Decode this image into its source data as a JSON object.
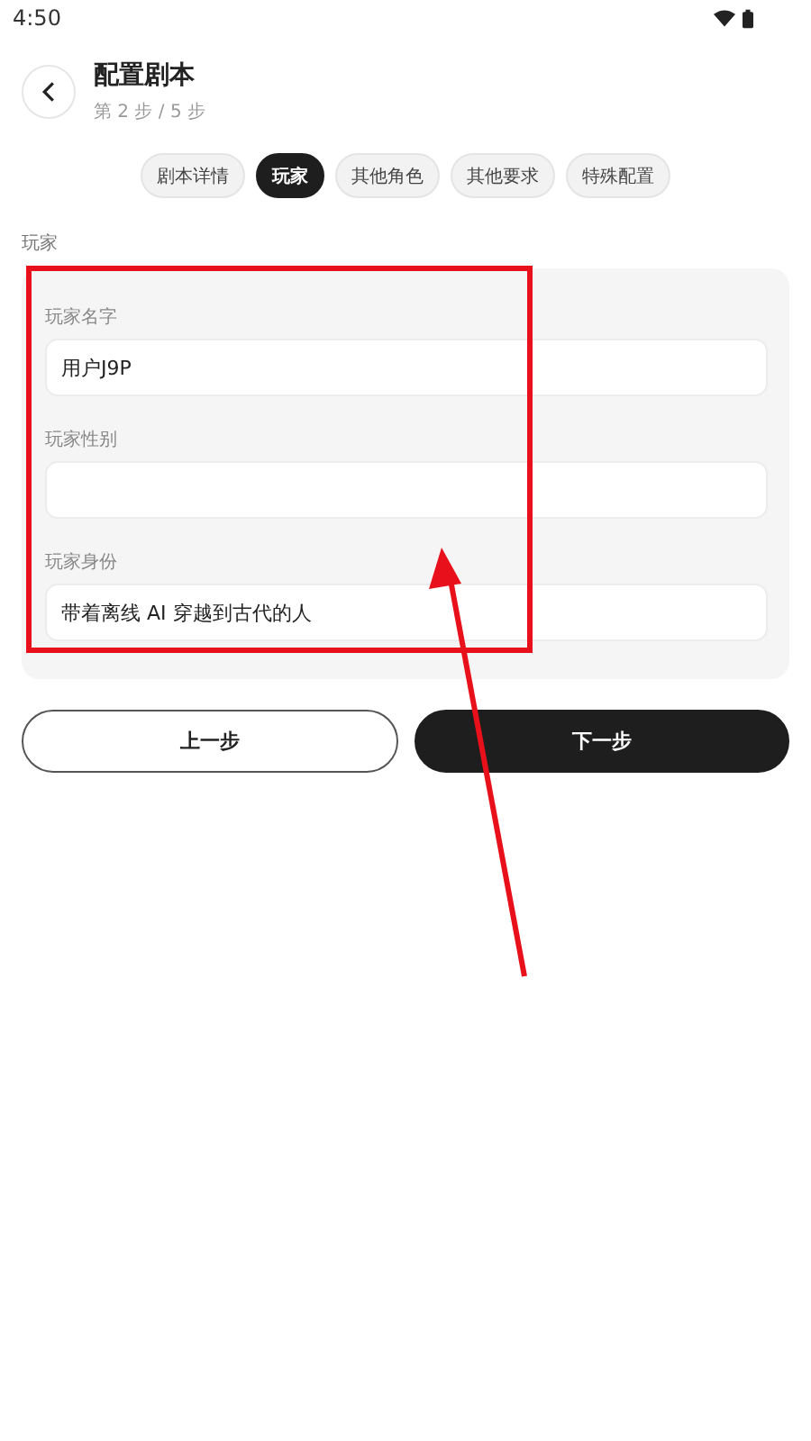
{
  "status_bar": {
    "time": "4:50"
  },
  "header": {
    "title": "配置剧本",
    "subtitle": "第 2 步 / 5 步"
  },
  "tabs": [
    {
      "label": "剧本详情",
      "selected": false
    },
    {
      "label": "玩家",
      "selected": true
    },
    {
      "label": "其他角色",
      "selected": false
    },
    {
      "label": "其他要求",
      "selected": false
    },
    {
      "label": "特殊配置",
      "selected": false
    }
  ],
  "section": {
    "title": "玩家",
    "fields": [
      {
        "label": "玩家名字",
        "value": "用户J9P"
      },
      {
        "label": "玩家性别"
      },
      {
        "label": "玩家身份",
        "value": "带着离线 AI 穿越到古代的人"
      }
    ]
  },
  "buttons": [
    {
      "label": "上一步",
      "kind": "secondary"
    },
    {
      "label": "下一步",
      "kind": "primary"
    }
  ]
}
